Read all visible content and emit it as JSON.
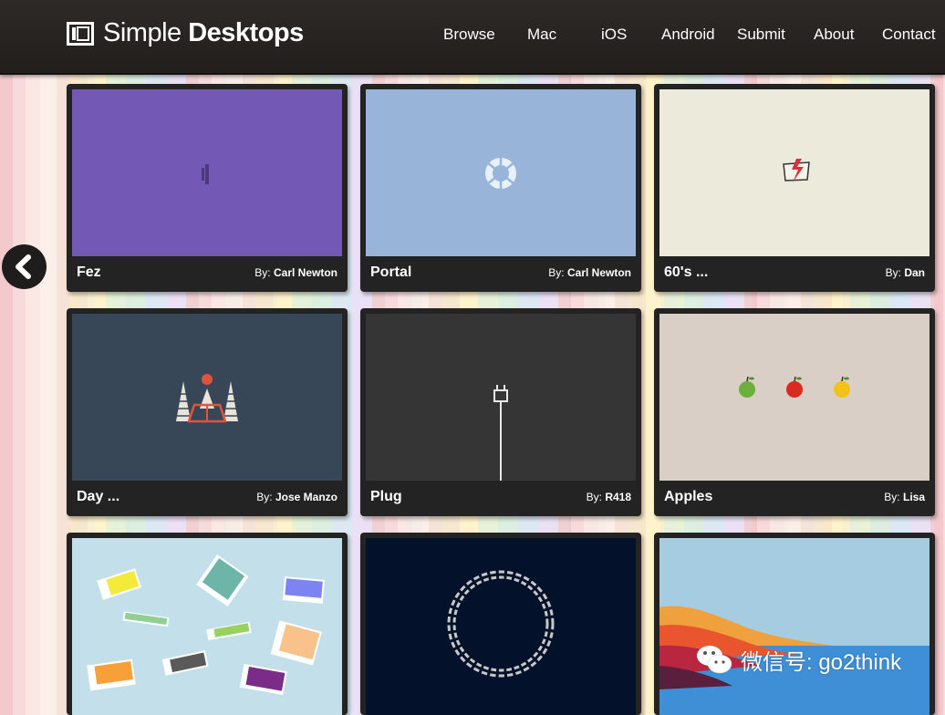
{
  "header": {
    "logo_light": "Simple ",
    "logo_bold": "Desktops",
    "nav": [
      "Browse",
      "Mac",
      "iOS",
      "Android",
      "Submit",
      "About",
      "Contact"
    ]
  },
  "pager": {
    "prev_icon": "chevron-left-icon"
  },
  "cards": [
    {
      "title": "Fez",
      "by": "By:",
      "author": "Carl Newton",
      "bg": "#7458b5"
    },
    {
      "title": "Portal",
      "by": "By:",
      "author": "Carl Newton",
      "bg": "#98b4d8"
    },
    {
      "title": "60's ...",
      "by": "By:",
      "author": "Dan",
      "bg": "#eceadb"
    },
    {
      "title": "Day ...",
      "by": "By:",
      "author": "Jose Manzo",
      "bg": "#384757"
    },
    {
      "title": "Plug",
      "by": "By:",
      "author": "R418",
      "bg": "#353535"
    },
    {
      "title": "Apples",
      "by": "By:",
      "author": "Lisa",
      "bg": "#d9cfc6"
    },
    {
      "title": "",
      "by": "",
      "author": "",
      "bg": "#c3e0ea"
    },
    {
      "title": "",
      "by": "",
      "author": "",
      "bg": "#03112a"
    },
    {
      "title": "",
      "by": "",
      "author": "",
      "bg": "#a5cce0"
    }
  ],
  "watermark": {
    "text": "微信号: go2think"
  }
}
